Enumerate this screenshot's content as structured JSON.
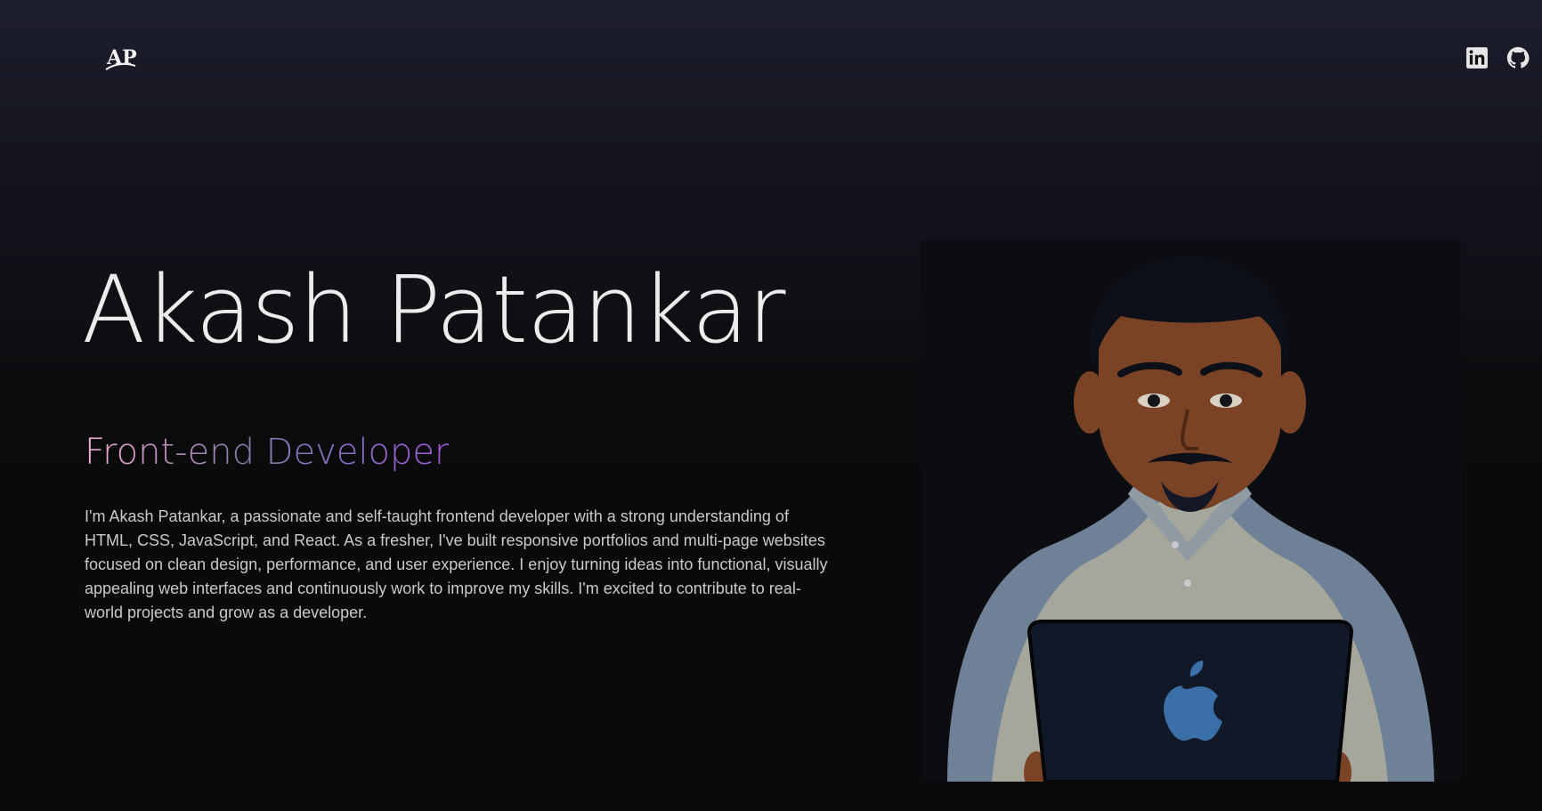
{
  "header": {
    "logo_text": "AP",
    "social": [
      {
        "icon": "linkedin-icon"
      },
      {
        "icon": "github-icon"
      }
    ]
  },
  "hero": {
    "name": "Akash Patankar",
    "role": "Front-end Developer",
    "bio": "I'm Akash Patankar, a passionate and self-taught frontend developer with a strong understanding of HTML, CSS, JavaScript, and React. As a fresher, I've built responsive portfolios and multi-page websites focused on clean design, performance, and user experience. I enjoy turning ideas into functional, visually appealing web interfaces and continuously work to improve my skills. I'm excited to contribute to real-world projects and grow as a developer."
  },
  "colors": {
    "background": "#0a0a0b",
    "gradient_pink": "#f0b3d4",
    "gradient_purple": "#a35ad9"
  }
}
